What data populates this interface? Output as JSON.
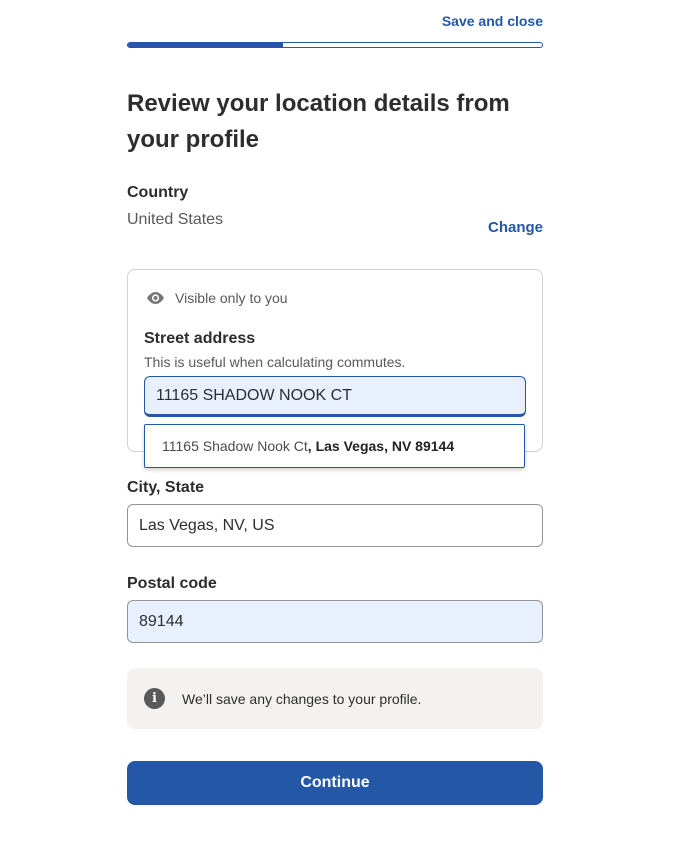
{
  "header": {
    "save_close_label": "Save and close",
    "progress_fraction": 0.375
  },
  "page_title": "Review your location details from your profile",
  "country": {
    "label": "Country",
    "value": "United States",
    "change_label": "Change"
  },
  "street_section": {
    "visibility_icon": "eye-icon",
    "visibility_text": "Visible only to you",
    "label": "Street address",
    "help_text": "This is useful when calculating commutes.",
    "value": "11165 SHADOW NOOK CT",
    "suggestion": {
      "street_part": "11165 Shadow Nook Ct",
      "separator": ", ",
      "city_part": "Las Vegas, NV 89144"
    }
  },
  "city_state": {
    "label": "City, State",
    "value": "Las Vegas, NV, US"
  },
  "postal_code": {
    "label": "Postal code",
    "value": "89144"
  },
  "notice": {
    "icon": "info-icon",
    "text": "We’ll save any changes to your profile."
  },
  "continue_label": "Continue",
  "colors": {
    "accent": "#2557a7",
    "autofill_bg": "#e8f0fe",
    "notice_bg": "#f3f2f1"
  }
}
